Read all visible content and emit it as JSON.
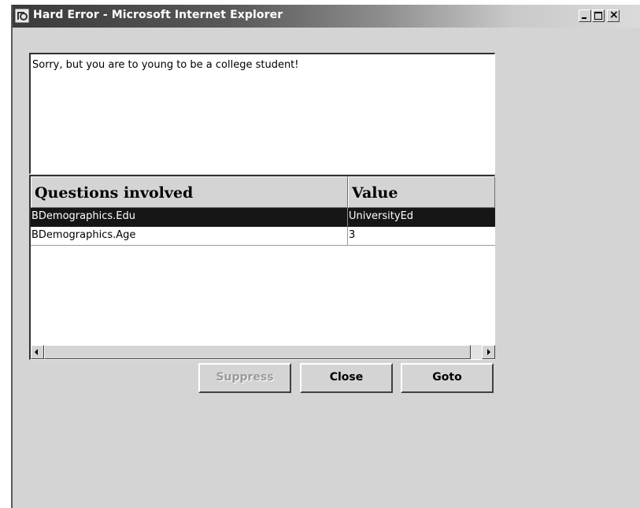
{
  "window": {
    "title": "Hard Error - Microsoft Internet Explorer",
    "controls": {
      "minimize": "_",
      "maximize": "□",
      "close": "×"
    }
  },
  "message": {
    "text": "Sorry, but you are to young to be a college student!"
  },
  "grid": {
    "headers": [
      "Questions involved",
      "Value"
    ],
    "rows": [
      {
        "question": "BDemographics.Edu",
        "value": "UniversityEd",
        "selected": true
      },
      {
        "question": "BDemographics.Age",
        "value": "3",
        "selected": false
      }
    ]
  },
  "buttons": {
    "suppress": "Suppress",
    "close": "Close",
    "goto": "Goto"
  },
  "icons": {
    "app": "ie-icon",
    "scroll_left": "scroll-left-arrow-icon",
    "scroll_right": "scroll-right-arrow-icon"
  },
  "colors": {
    "dialog_bg": "#d4d4d4",
    "selected_row_bg": "#161616",
    "selected_row_text": "#ffffff",
    "disabled_text": "#9a9a9a"
  }
}
